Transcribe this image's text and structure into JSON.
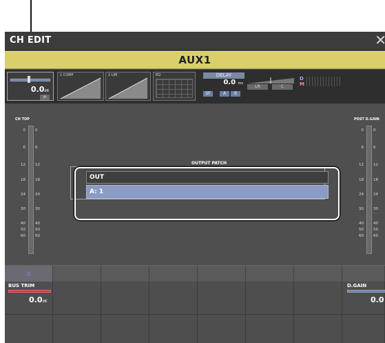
{
  "window": {
    "title": "CH EDIT",
    "close_symbol": "✕"
  },
  "channel": {
    "name": "AUX1"
  },
  "module_strip": {
    "fader": {
      "value": "0.0",
      "unit": "dB",
      "phase_label": "ø"
    },
    "comp": {
      "label": "1 COMP"
    },
    "lim": {
      "label": "2 LIM"
    },
    "eq": {
      "label": "EQ"
    },
    "delay": {
      "label": "DELAY",
      "value": "0.0",
      "unit": "ms",
      "sf_label": "SF",
      "a_label": "A",
      "b_label": "B"
    },
    "pan": {
      "lr_label": "LR",
      "c_label": "C"
    },
    "dm": {
      "d_label": "D",
      "m_label": "M"
    }
  },
  "meters": {
    "left_title": "CH TOP",
    "right_title": "POST D.GAIN",
    "scale": [
      "0",
      "6",
      "12",
      "18",
      "24",
      "30",
      "40",
      "50",
      "60"
    ]
  },
  "output_patch": {
    "title": "OUTPUT PATCH",
    "header": "OUT",
    "selected": "A: 1"
  },
  "tabs": {
    "selected_symbol": "ø"
  },
  "bus_trim": {
    "label": "BUS TRIM",
    "value": "0.0",
    "unit": "dB"
  },
  "d_gain": {
    "label": "D.GAIN",
    "value": "0.0"
  },
  "colors": {
    "title_bar": "#3c3c3c",
    "channel_strip": "#d9d06c",
    "selected_row": "#8a9bc4",
    "accent_red": "#c04040"
  }
}
